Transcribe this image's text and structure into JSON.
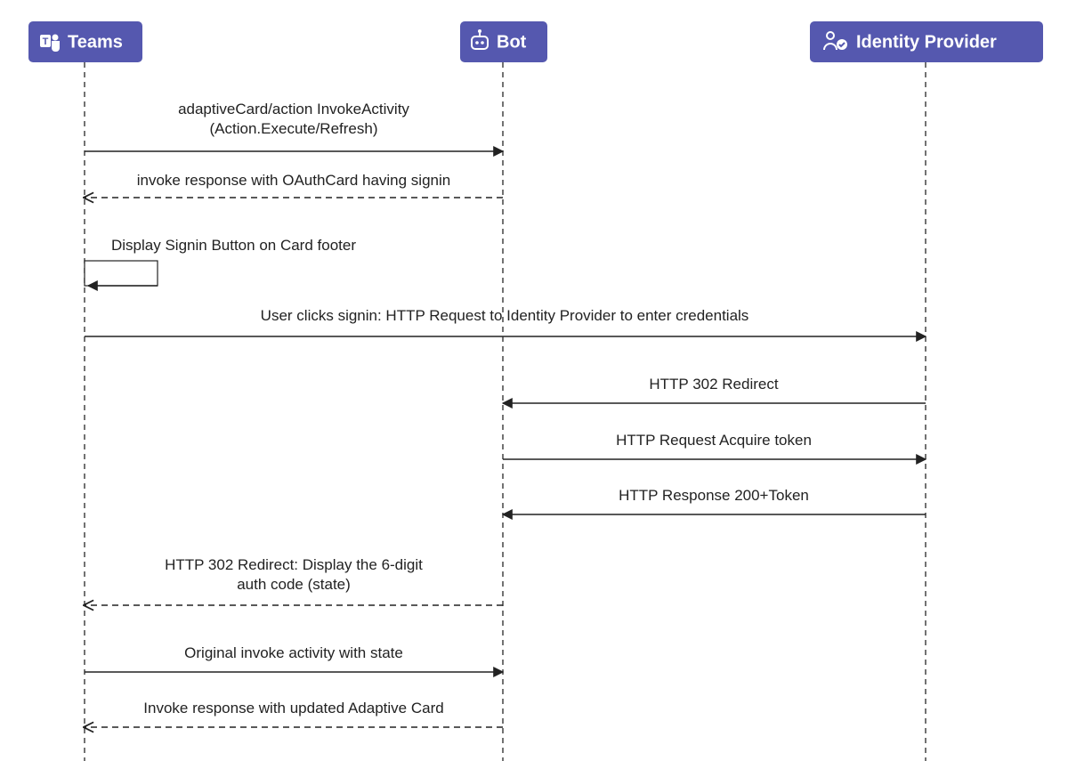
{
  "colors": {
    "participant": "#5558af",
    "text_on_participant": "#ffffff",
    "line": "#222"
  },
  "participants": [
    {
      "id": "teams",
      "label": "Teams",
      "icon": "teams-icon"
    },
    {
      "id": "bot",
      "label": "Bot",
      "icon": "bot-icon"
    },
    {
      "id": "idp",
      "label": "Identity Provider",
      "icon": "identity-icon"
    }
  ],
  "messages": {
    "m1a": "adaptiveCard/action InvokeActivity",
    "m1b": "(Action.Execute/Refresh)",
    "m2": "invoke response with OAuthCard having signin",
    "m3": "Display Signin Button on Card footer",
    "m4": "User clicks signin: HTTP Request to Identity Provider to enter credentials",
    "m5": "HTTP 302 Redirect",
    "m6": "HTTP Request Acquire token",
    "m7": "HTTP Response 200+Token",
    "m8a": "HTTP 302 Redirect: Display the 6-digit",
    "m8b": "auth code (state)",
    "m9": "Original invoke activity with state",
    "m10": "Invoke response with updated Adaptive Card"
  },
  "chart_data": {
    "type": "sequence-diagram",
    "participants": [
      "Teams",
      "Bot",
      "Identity Provider"
    ],
    "interactions": [
      {
        "from": "Teams",
        "to": "Bot",
        "style": "solid",
        "text": "adaptiveCard/action InvokeActivity (Action.Execute/Refresh)"
      },
      {
        "from": "Bot",
        "to": "Teams",
        "style": "dashed",
        "text": "invoke response with OAuthCard having signin"
      },
      {
        "from": "Teams",
        "to": "Teams",
        "style": "self",
        "text": "Display Signin Button on Card footer"
      },
      {
        "from": "Teams",
        "to": "Identity Provider",
        "style": "solid",
        "text": "User clicks signin: HTTP Request to Identity Provider to enter credentials"
      },
      {
        "from": "Identity Provider",
        "to": "Bot",
        "style": "solid",
        "text": "HTTP 302 Redirect"
      },
      {
        "from": "Bot",
        "to": "Identity Provider",
        "style": "solid",
        "text": "HTTP Request Acquire token"
      },
      {
        "from": "Identity Provider",
        "to": "Bot",
        "style": "solid",
        "text": "HTTP Response 200+Token"
      },
      {
        "from": "Bot",
        "to": "Teams",
        "style": "dashed",
        "text": "HTTP 302 Redirect: Display the 6-digit auth code (state)"
      },
      {
        "from": "Teams",
        "to": "Bot",
        "style": "solid",
        "text": "Original invoke activity with state"
      },
      {
        "from": "Bot",
        "to": "Teams",
        "style": "dashed",
        "text": "Invoke response with updated Adaptive Card"
      }
    ]
  }
}
